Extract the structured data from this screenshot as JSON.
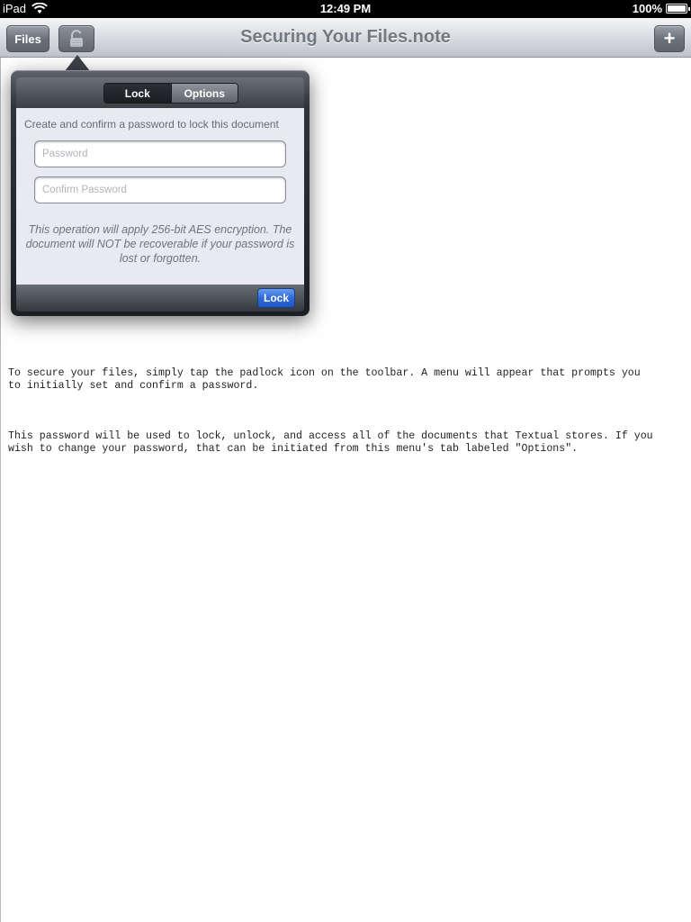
{
  "status_bar": {
    "device": "iPad",
    "time": "12:49 PM",
    "battery": "100%"
  },
  "navbar": {
    "files_label": "Files",
    "title": "Securing Your Files.note",
    "add_label": "+"
  },
  "popover": {
    "tabs": [
      "Lock",
      "Options"
    ],
    "selected_tab": "Lock",
    "instruction": "Create and confirm a password to lock this document",
    "password_placeholder": "Password",
    "confirm_placeholder": "Confirm Password",
    "note": "This operation will apply 256-bit AES encryption. The document will NOT be recoverable if your password is lost or forgotten.",
    "lock_button": "Lock"
  },
  "document": {
    "paragraphs": [
      "To secure your files, simply tap the padlock icon on the toolbar. A menu will appear that prompts you\nto initially set and confirm a password.",
      "This password will be used to lock, unlock, and access all of the documents that Textual stores. If you\nwish to change your password, that can be initiated from this menu's tab labeled \"Options\"."
    ]
  },
  "colors": {
    "lock_button_blue": "#2e6ad8",
    "navbar_title": "#727982"
  },
  "icons": {
    "wifi": "wifi-icon",
    "battery": "battery-icon",
    "padlock": "padlock-icon"
  }
}
